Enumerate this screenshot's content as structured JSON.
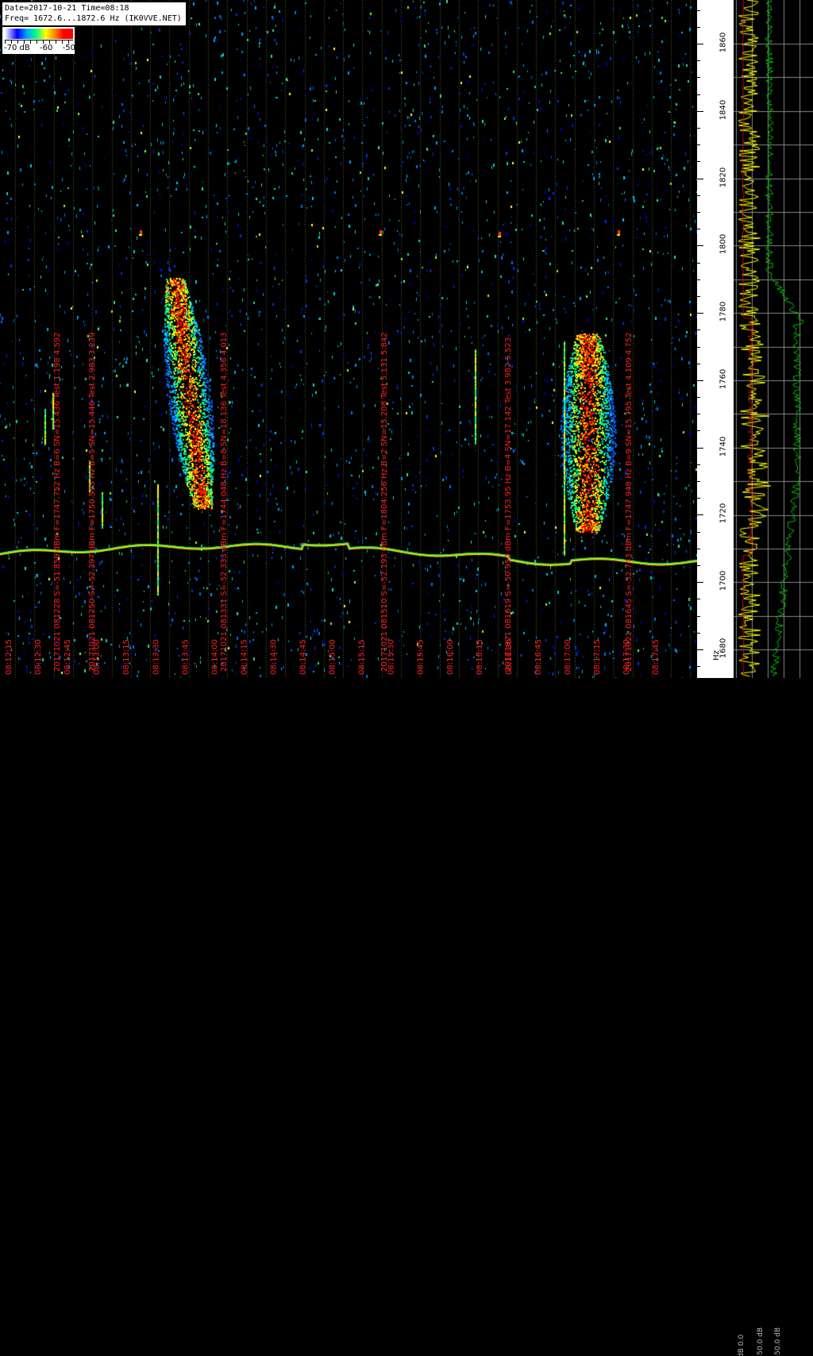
{
  "header": {
    "line1": "Date=2017-10-21 Time=08:18",
    "line2": "Freq= 1672.6...1872.6 Hz (IK0VVE.NET)"
  },
  "legend": {
    "labels": [
      "-70 dB",
      "-60",
      "-50"
    ]
  },
  "freq_axis": {
    "unit": "Hz",
    "labels": [
      {
        "text": "1860",
        "hz": 1860
      },
      {
        "text": "1840",
        "hz": 1840
      },
      {
        "text": "1820",
        "hz": 1820
      },
      {
        "text": "1800",
        "hz": 1800
      },
      {
        "text": "1780",
        "hz": 1780
      },
      {
        "text": "1760",
        "hz": 1760
      },
      {
        "text": "1740",
        "hz": 1740
      },
      {
        "text": "1720",
        "hz": 1720
      },
      {
        "text": "1700",
        "hz": 1700
      },
      {
        "text": "1680",
        "hz": 1680
      }
    ],
    "range": [
      1672.6,
      1872.6
    ]
  },
  "time_labels": [
    "08:12:15",
    "08:12:30",
    "08:12:45",
    "08:13:00",
    "08:13:15",
    "08:13:30",
    "08:13:45",
    "08:14:00",
    "08:14:15",
    "08:14:30",
    "08:14:45",
    "08:15:00",
    "08:15:15",
    "08:15:30",
    "08:15:45",
    "08:16:00",
    "08:16:15",
    "08:16:30",
    "08:16:45",
    "08:17:00",
    "08:17:15",
    "08:17:30",
    "08:17:45"
  ],
  "detections": [
    "20171021 081228 S=-51.859 dBm F=1747.752 Hz B=6 SN=15.436 Test 1.198 4.592",
    "20171021 081250 S=-52.397 dBm F=1750.595 Hz B=5 SN=15.446 Test 2.983 3.239",
    "20171021 081331 S=-52.333 dBm F=1744.048 Hz B=8 SN=18.136 Test 4.356 4.013",
    "20171021 081510 S=-52.193 dBm F=1804.256 Hz B=2 SN=15.208 Test 5.131 5.842",
    "20171021 081619 S=-50.950 dBm F=1753.95 Hz B=4 SN=17.142 Test 3.982 5.523",
    "20171021 081645 S=-52.743 dBm F=1747.948 Hz B=9 SN=15.795 Test 4.109 4.752"
  ],
  "side_panel": {
    "labels": [
      "dB 0.0",
      "-50.0 dB",
      "-50.0 dB"
    ]
  },
  "colors": {
    "background": "#000000",
    "signal": "#ff0000",
    "timestamp_text": "#ff2020",
    "grid_lines": "#5a6a2a",
    "trace_yellow": "#ffff00",
    "trace_green": "#00c000",
    "trace_red": "#c01010"
  }
}
